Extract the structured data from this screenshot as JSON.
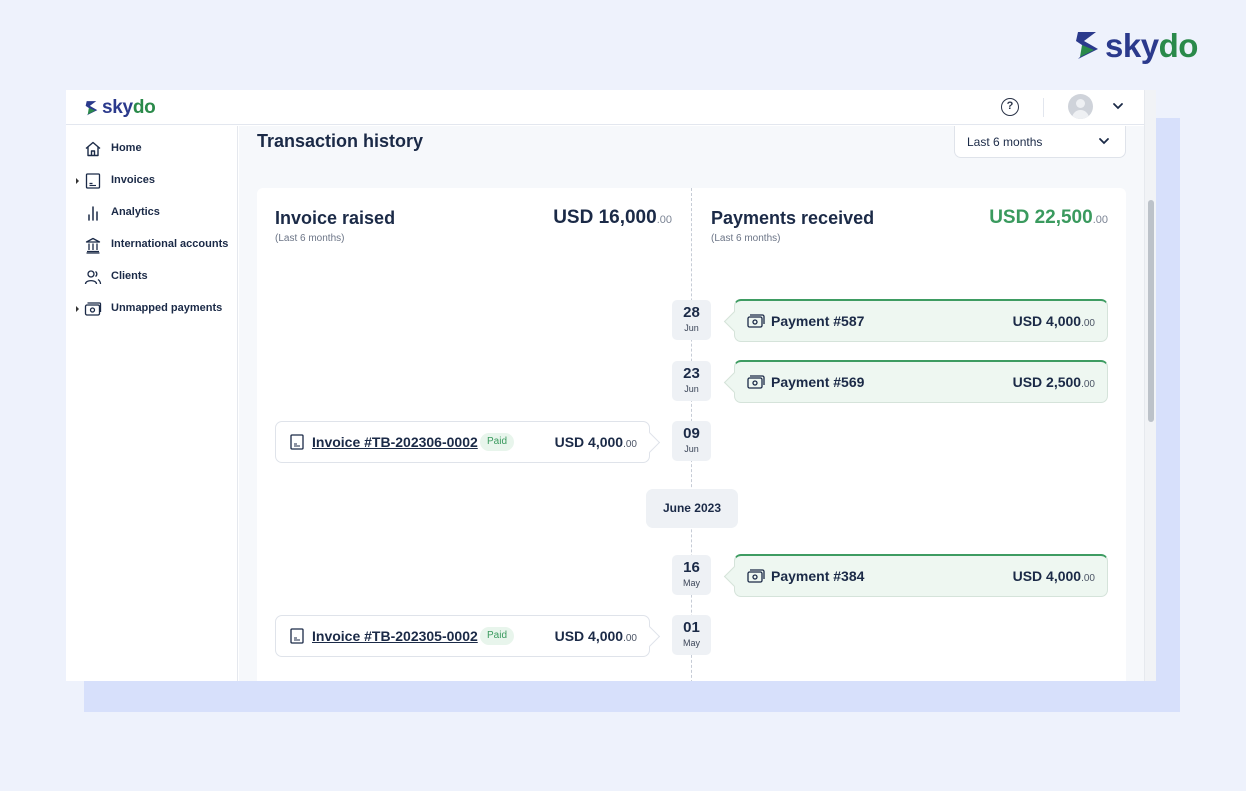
{
  "brand": {
    "name_part1": "sky",
    "name_part2": "do"
  },
  "header": {
    "help_icon": "question-circle-icon",
    "avatar_icon": "user-avatar-icon",
    "menu_icon": "chevron-down-icon"
  },
  "sidebar": {
    "items": [
      {
        "label": "Home",
        "icon": "home-icon",
        "expandable": false
      },
      {
        "label": "Invoices",
        "icon": "invoice-icon",
        "expandable": true
      },
      {
        "label": "Analytics",
        "icon": "bar-chart-icon",
        "expandable": false
      },
      {
        "label": "International accounts",
        "icon": "bank-icon",
        "expandable": false
      },
      {
        "label": "Clients",
        "icon": "users-icon",
        "expandable": false
      },
      {
        "label": "Unmapped payments",
        "icon": "cash-icon",
        "expandable": true
      }
    ]
  },
  "main": {
    "title": "Transaction history",
    "period_select": {
      "value": "Last 6 months"
    },
    "summary": {
      "invoices": {
        "title": "Invoice raised",
        "subtitle": "(Last 6 months)",
        "amount": "USD 16,000",
        "cents": ".00"
      },
      "payments": {
        "title": "Payments received",
        "subtitle": "(Last 6 months)",
        "amount": "USD 22,500",
        "cents": ".00",
        "color": "#3a9a5e"
      }
    },
    "timeline": [
      {
        "day": "28",
        "month": "Jun",
        "type": "payment",
        "label": "Payment #587",
        "amount": "USD 4,000",
        "cents": ".00"
      },
      {
        "day": "23",
        "month": "Jun",
        "type": "payment",
        "label": "Payment #569",
        "amount": "USD 2,500",
        "cents": ".00"
      },
      {
        "day": "09",
        "month": "Jun",
        "type": "invoice",
        "label": "Invoice #TB-202306-0002",
        "status": "Paid",
        "amount": "USD 4,000",
        "cents": ".00"
      },
      {
        "separator": "June 2023"
      },
      {
        "day": "16",
        "month": "May",
        "type": "payment",
        "label": "Payment #384",
        "amount": "USD 4,000",
        "cents": ".00"
      },
      {
        "day": "01",
        "month": "May",
        "type": "invoice",
        "label": "Invoice #TB-202305-0002",
        "status": "Paid",
        "amount": "USD 4,000",
        "cents": ".00"
      }
    ]
  },
  "colors": {
    "brand_blue": "#2b3a8c",
    "brand_green": "#2a8a4a",
    "accent_green": "#3e9c62",
    "text_dark": "#1b2a47"
  }
}
